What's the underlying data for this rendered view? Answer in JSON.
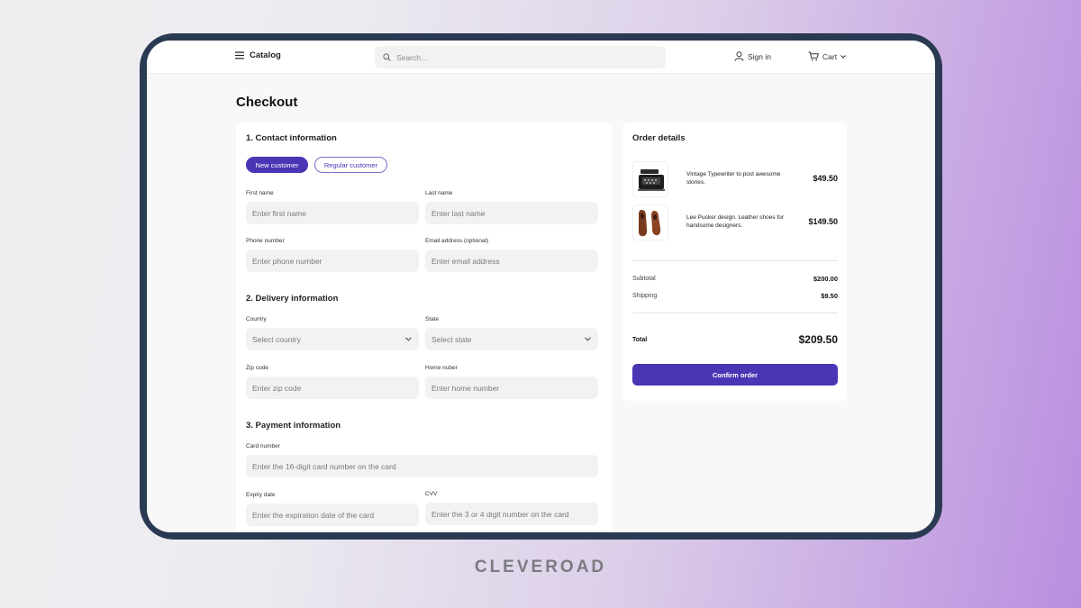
{
  "header": {
    "catalog_label": "Catalog",
    "search_placeholder": "Search...",
    "signin_label": "Sign in",
    "cart_label": "Cart"
  },
  "page_title": "Checkout",
  "contact": {
    "title": "1. Contact information",
    "tabs": [
      {
        "label": "New customer",
        "active": true
      },
      {
        "label": "Regular customer",
        "active": false
      }
    ],
    "first_name": {
      "label": "First name",
      "placeholder": "Enter first name"
    },
    "last_name": {
      "label": "Last name",
      "placeholder": "Enter last name"
    },
    "phone": {
      "label": "Phone number",
      "placeholder": "Enter phone number"
    },
    "email": {
      "label": "Email address (optional)",
      "placeholder": "Enter email address"
    }
  },
  "delivery": {
    "title": "2. Delivery information",
    "country": {
      "label": "Country",
      "value": "Select country"
    },
    "state": {
      "label": "State",
      "value": "Select state"
    },
    "zip": {
      "label": "Zip code",
      "placeholder": "Enter zip code"
    },
    "home": {
      "label": "Home nuber",
      "placeholder": "Enter home number"
    }
  },
  "payment": {
    "title": "3. Payment information",
    "card": {
      "label": "Card number",
      "placeholder": "Enter the 16-digit card number on the card"
    },
    "expiry": {
      "label": "Expiry date",
      "placeholder": "Enter the expiration date of the card"
    },
    "cvv": {
      "label": "CVV",
      "placeholder": "Enter the 3 or 4 digit number on the card"
    }
  },
  "order": {
    "title": "Order details",
    "items": [
      {
        "description": "Vintage Typewriter to post awesome stories.",
        "price": "$49.50",
        "icon": "typewriter-image"
      },
      {
        "description": "Lee Pucker design. Leather shoes for handsome designers.",
        "price": "$149.50",
        "icon": "shoes-image"
      }
    ],
    "subtotal_label": "Subtotal",
    "subtotal_value": "$200.00",
    "shipping_label": "Shipping",
    "shipping_value": "$9.50",
    "total_label": "Total",
    "total_value": "$209.50",
    "confirm_label": "Confirm order"
  },
  "brand": "CLEVEROAD",
  "colors": {
    "accent": "#4a36b5",
    "device_frame": "#2a3a52"
  }
}
